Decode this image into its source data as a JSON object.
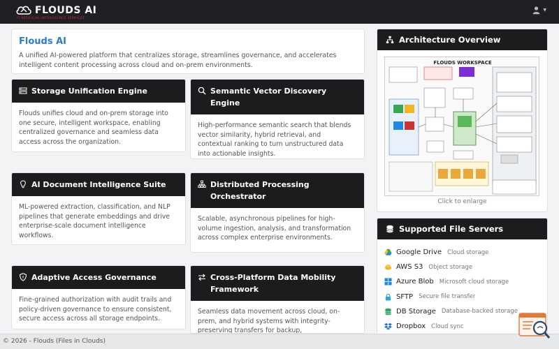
{
  "app": {
    "brand_name": "FLOUDS AI",
    "brand_tagline": "IT ARTIFICIAL INTELLIGENCE SERVICES"
  },
  "intro": {
    "title": "Flouds AI",
    "description": "A unified AI-powered platform that centralizes storage, streamlines governance, and accelerates intelligent content processing across cloud and on-prem environments."
  },
  "features": [
    {
      "icon": "storage-icon",
      "title": "Storage Unification Engine",
      "body": "Flouds unifies cloud and on-prem storage into one secure, intelligent workspace, enabling centralized governance and seamless data access across the organization."
    },
    {
      "icon": "search-icon",
      "title": "Semantic Vector Discovery Engine",
      "body": "High-performance semantic search that blends vector similarity, hybrid retrieval, and contextual ranking to turn unstructured data into actionable insights."
    },
    {
      "icon": "lightbulb-icon",
      "title": "AI Document Intelligence Suite",
      "body": "ML-powered extraction, classification, and NLP pipelines that generate embeddings and drive enterprise-scale document intelligence workflows."
    },
    {
      "icon": "network-icon",
      "title": "Distributed Processing Orchestrator",
      "body": "Scalable, asynchronous pipelines for high-volume ingestion, analysis, and transformation across complex enterprise environments."
    },
    {
      "icon": "shield-icon",
      "title": "Adaptive Access Governance",
      "body": "Fine-grained authorization with audit trails and policy-driven governance to ensure consistent, secure access across all storage endpoints."
    },
    {
      "icon": "transfer-arrows-icon",
      "title": "Cross-Platform Data Mobility Framework",
      "body": "Seamless data movement across cloud, on-prem, and hybrid systems with integrity-preserving transfers for backup,"
    }
  ],
  "architecture": {
    "title": "Architecture Overview",
    "image_title": "FLOUDS WORKSPACE",
    "caption": "Click to enlarge"
  },
  "file_servers": {
    "title": "Supported File Servers",
    "items": [
      {
        "name": "Google Drive",
        "desc": "Cloud storage",
        "icon": "google-drive-icon",
        "color": "#34a853"
      },
      {
        "name": "AWS S3",
        "desc": "Object storage",
        "icon": "aws-s3-icon",
        "color": "#f2b620"
      },
      {
        "name": "Azure Blob",
        "desc": "Microsoft cloud storage",
        "icon": "windows-icon",
        "color": "#1e88e5"
      },
      {
        "name": "SFTP",
        "desc": "Secure file transfer",
        "icon": "lock-icon",
        "color": "#29a7d8"
      },
      {
        "name": "DB Storage",
        "desc": "Database-backed storage",
        "icon": "database-icon",
        "color": "#2ca36a"
      },
      {
        "name": "Dropbox",
        "desc": "Cloud sync",
        "icon": "dropbox-icon",
        "color": "#1e6fe3"
      }
    ]
  },
  "footer": {
    "text": "© 2026 - Flouds (Files in Clouds)"
  },
  "colors": {
    "accent": "#2a7ad6",
    "header_bg": "#1c1c1e",
    "brand_red": "#d22244"
  }
}
